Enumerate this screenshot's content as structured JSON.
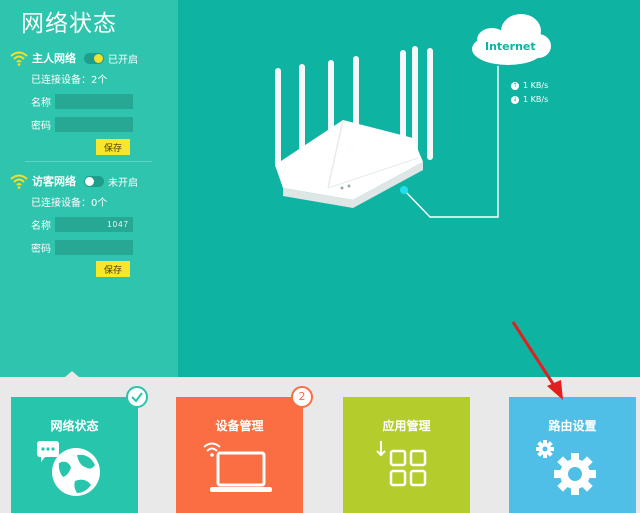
{
  "page_title": "网络状态",
  "host_network": {
    "name": "主人网络",
    "toggle_state": "on",
    "toggle_text": "已开启",
    "connected_devices": "已连接设备：2个",
    "name_label": "名称",
    "name_value": "",
    "password_label": "密码",
    "password_value": "",
    "save_label": "保存"
  },
  "guest_network": {
    "name": "访客网络",
    "toggle_state": "off",
    "toggle_text": "未开启",
    "connected_devices": "已连接设备：0个",
    "name_label": "名称",
    "name_value": "1047",
    "password_label": "密码",
    "password_value": "",
    "save_label": "保存"
  },
  "topology": {
    "internet_label": "Internet",
    "upload_speed": "1 KB/s",
    "download_speed": "1 KB/s"
  },
  "tiles": [
    {
      "label": "网络状态",
      "icon": "globe-chat-icon",
      "badge": "check"
    },
    {
      "label": "设备管理",
      "icon": "laptop-wifi-icon",
      "badge": "2"
    },
    {
      "label": "应用管理",
      "icon": "app-grid-icon",
      "badge": ""
    },
    {
      "label": "路由设置",
      "icon": "gears-icon",
      "badge": ""
    }
  ],
  "colors": {
    "left_panel": "#2ec4ad",
    "right_panel": "#0fb3a2",
    "tile_network": "#28c5ad",
    "tile_device": "#fb6e43",
    "tile_app": "#b5cc2d",
    "tile_router": "#4fbfe7",
    "save_button": "#f8e62c",
    "annotation_arrow": "#e02020"
  }
}
